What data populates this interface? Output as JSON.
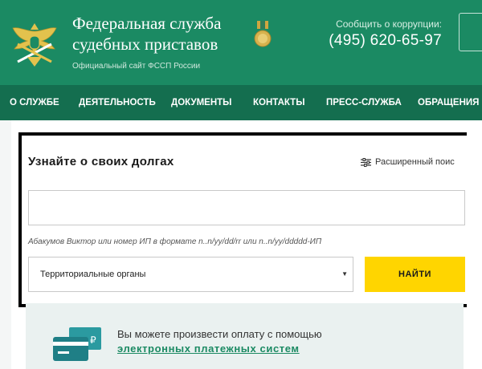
{
  "header": {
    "title": "Федеральная служба судебных приставов",
    "subtitle": "Официальный сайт ФССП России",
    "corruption_label": "Сообщить о коррупции:",
    "corruption_phone": "(495) 620-65-97",
    "emblem_icon": "eagle-emblem-icon",
    "medal_icon": "medal-icon"
  },
  "nav": {
    "items": [
      {
        "label": "О СЛУЖБЕ"
      },
      {
        "label": "ДЕЯТЕЛЬНОСТЬ"
      },
      {
        "label": "ДОКУМЕНТЫ"
      },
      {
        "label": "КОНТАКТЫ"
      },
      {
        "label": "ПРЕСС-СЛУЖБА"
      },
      {
        "label": "ОБРАЩЕНИЯ"
      }
    ]
  },
  "search": {
    "title": "Узнайте о своих долгах",
    "advanced_label": "Расширенный поис",
    "input_value": "",
    "hint": "Абакумов Виктор или номер ИП в формате n..n/yy/dd/rr или n..n/yy/ddddd-ИП",
    "select_value": "Территориальные органы",
    "find_label": "НАЙТИ"
  },
  "payment": {
    "text": "Вы можете произвести оплату с помощью",
    "link": "электронных платежных систем",
    "icon": "credit-card-icon"
  },
  "colors": {
    "header_green": "#1b8a63",
    "nav_green": "#146e4f",
    "find_yellow": "#ffd500",
    "link_green": "#1b8a63"
  }
}
